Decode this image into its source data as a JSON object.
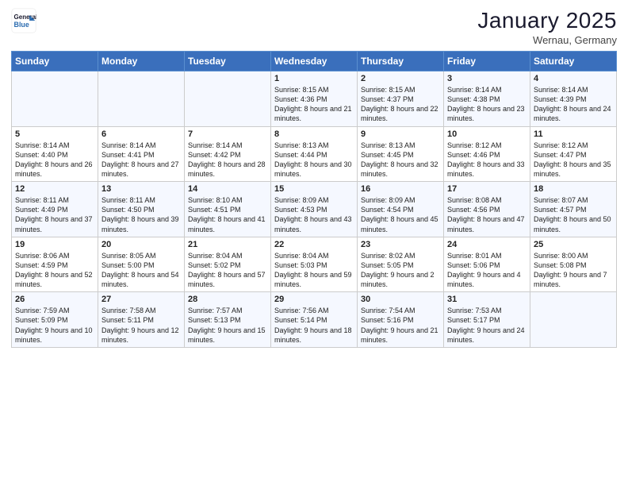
{
  "header": {
    "logo_line1": "General",
    "logo_line2": "Blue",
    "month": "January 2025",
    "location": "Wernau, Germany"
  },
  "weekdays": [
    "Sunday",
    "Monday",
    "Tuesday",
    "Wednesday",
    "Thursday",
    "Friday",
    "Saturday"
  ],
  "weeks": [
    [
      {
        "day": "",
        "info": ""
      },
      {
        "day": "",
        "info": ""
      },
      {
        "day": "",
        "info": ""
      },
      {
        "day": "1",
        "info": "Sunrise: 8:15 AM\nSunset: 4:36 PM\nDaylight: 8 hours\nand 21 minutes."
      },
      {
        "day": "2",
        "info": "Sunrise: 8:15 AM\nSunset: 4:37 PM\nDaylight: 8 hours\nand 22 minutes."
      },
      {
        "day": "3",
        "info": "Sunrise: 8:14 AM\nSunset: 4:38 PM\nDaylight: 8 hours\nand 23 minutes."
      },
      {
        "day": "4",
        "info": "Sunrise: 8:14 AM\nSunset: 4:39 PM\nDaylight: 8 hours\nand 24 minutes."
      }
    ],
    [
      {
        "day": "5",
        "info": "Sunrise: 8:14 AM\nSunset: 4:40 PM\nDaylight: 8 hours\nand 26 minutes."
      },
      {
        "day": "6",
        "info": "Sunrise: 8:14 AM\nSunset: 4:41 PM\nDaylight: 8 hours\nand 27 minutes."
      },
      {
        "day": "7",
        "info": "Sunrise: 8:14 AM\nSunset: 4:42 PM\nDaylight: 8 hours\nand 28 minutes."
      },
      {
        "day": "8",
        "info": "Sunrise: 8:13 AM\nSunset: 4:44 PM\nDaylight: 8 hours\nand 30 minutes."
      },
      {
        "day": "9",
        "info": "Sunrise: 8:13 AM\nSunset: 4:45 PM\nDaylight: 8 hours\nand 32 minutes."
      },
      {
        "day": "10",
        "info": "Sunrise: 8:12 AM\nSunset: 4:46 PM\nDaylight: 8 hours\nand 33 minutes."
      },
      {
        "day": "11",
        "info": "Sunrise: 8:12 AM\nSunset: 4:47 PM\nDaylight: 8 hours\nand 35 minutes."
      }
    ],
    [
      {
        "day": "12",
        "info": "Sunrise: 8:11 AM\nSunset: 4:49 PM\nDaylight: 8 hours\nand 37 minutes."
      },
      {
        "day": "13",
        "info": "Sunrise: 8:11 AM\nSunset: 4:50 PM\nDaylight: 8 hours\nand 39 minutes."
      },
      {
        "day": "14",
        "info": "Sunrise: 8:10 AM\nSunset: 4:51 PM\nDaylight: 8 hours\nand 41 minutes."
      },
      {
        "day": "15",
        "info": "Sunrise: 8:09 AM\nSunset: 4:53 PM\nDaylight: 8 hours\nand 43 minutes."
      },
      {
        "day": "16",
        "info": "Sunrise: 8:09 AM\nSunset: 4:54 PM\nDaylight: 8 hours\nand 45 minutes."
      },
      {
        "day": "17",
        "info": "Sunrise: 8:08 AM\nSunset: 4:56 PM\nDaylight: 8 hours\nand 47 minutes."
      },
      {
        "day": "18",
        "info": "Sunrise: 8:07 AM\nSunset: 4:57 PM\nDaylight: 8 hours\nand 50 minutes."
      }
    ],
    [
      {
        "day": "19",
        "info": "Sunrise: 8:06 AM\nSunset: 4:59 PM\nDaylight: 8 hours\nand 52 minutes."
      },
      {
        "day": "20",
        "info": "Sunrise: 8:05 AM\nSunset: 5:00 PM\nDaylight: 8 hours\nand 54 minutes."
      },
      {
        "day": "21",
        "info": "Sunrise: 8:04 AM\nSunset: 5:02 PM\nDaylight: 8 hours\nand 57 minutes."
      },
      {
        "day": "22",
        "info": "Sunrise: 8:04 AM\nSunset: 5:03 PM\nDaylight: 8 hours\nand 59 minutes."
      },
      {
        "day": "23",
        "info": "Sunrise: 8:02 AM\nSunset: 5:05 PM\nDaylight: 9 hours\nand 2 minutes."
      },
      {
        "day": "24",
        "info": "Sunrise: 8:01 AM\nSunset: 5:06 PM\nDaylight: 9 hours\nand 4 minutes."
      },
      {
        "day": "25",
        "info": "Sunrise: 8:00 AM\nSunset: 5:08 PM\nDaylight: 9 hours\nand 7 minutes."
      }
    ],
    [
      {
        "day": "26",
        "info": "Sunrise: 7:59 AM\nSunset: 5:09 PM\nDaylight: 9 hours\nand 10 minutes."
      },
      {
        "day": "27",
        "info": "Sunrise: 7:58 AM\nSunset: 5:11 PM\nDaylight: 9 hours\nand 12 minutes."
      },
      {
        "day": "28",
        "info": "Sunrise: 7:57 AM\nSunset: 5:13 PM\nDaylight: 9 hours\nand 15 minutes."
      },
      {
        "day": "29",
        "info": "Sunrise: 7:56 AM\nSunset: 5:14 PM\nDaylight: 9 hours\nand 18 minutes."
      },
      {
        "day": "30",
        "info": "Sunrise: 7:54 AM\nSunset: 5:16 PM\nDaylight: 9 hours\nand 21 minutes."
      },
      {
        "day": "31",
        "info": "Sunrise: 7:53 AM\nSunset: 5:17 PM\nDaylight: 9 hours\nand 24 minutes."
      },
      {
        "day": "",
        "info": ""
      }
    ]
  ]
}
